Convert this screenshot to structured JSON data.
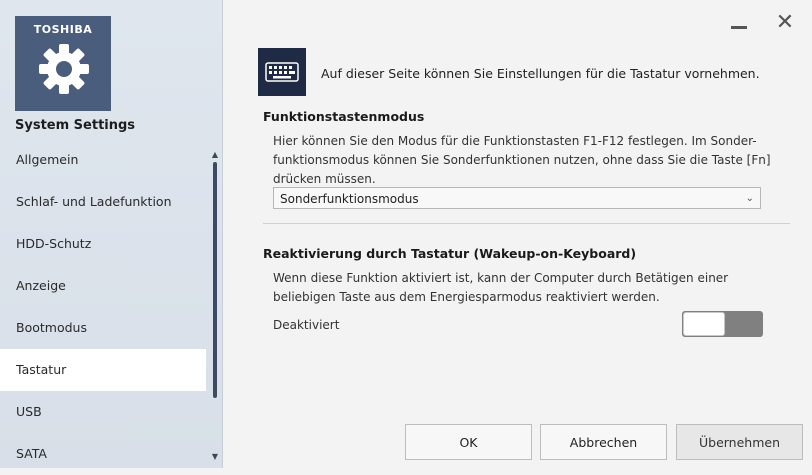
{
  "brand": "TOSHIBA",
  "app_title": "System Settings",
  "nav": [
    {
      "label": "Allgemein"
    },
    {
      "label": "Schlaf- und Ladefunktion"
    },
    {
      "label": "HDD-Schutz"
    },
    {
      "label": "Anzeige"
    },
    {
      "label": "Bootmodus"
    },
    {
      "label": "Tastatur",
      "active": true
    },
    {
      "label": "USB"
    },
    {
      "label": "SATA"
    }
  ],
  "window": {
    "close_glyph": "✕"
  },
  "intro": "Auf dieser Seite können Sie Einstellungen für die Tastatur vornehmen.",
  "function_keys": {
    "title": "Funktionstastenmodus",
    "desc_lines": [
      "Hier können Sie den Modus für die Funktionstasten F1-F12 festlegen. Im Sonder-",
      "funktionsmodus können Sie Sonderfunktionen nutzen, ohne dass Sie die Taste [Fn]",
      "drücken müssen."
    ],
    "selected": "Sonderfunktionsmodus"
  },
  "wakeup": {
    "title": "Reaktivierung durch Tastatur (Wakeup-on-Keyboard)",
    "desc_lines": [
      "Wenn diese Funktion aktiviert ist, kann der Computer durch Betätigen einer",
      "beliebigen Taste aus dem Energiesparmodus reaktiviert werden."
    ],
    "state_label": "Deaktiviert",
    "enabled": false
  },
  "buttons": {
    "ok": "OK",
    "cancel": "Abbrechen",
    "apply": "Übernehmen"
  },
  "icons": {
    "logo": "gear-icon",
    "page": "keyboard-icon",
    "minimize": "minimize-icon",
    "close": "close-icon",
    "dropdown": "chevron-down-icon"
  },
  "colors": {
    "logo_tile": "#4b5d7c",
    "keyboard_tile": "#1f2a44",
    "toggle_off": "#808080"
  }
}
